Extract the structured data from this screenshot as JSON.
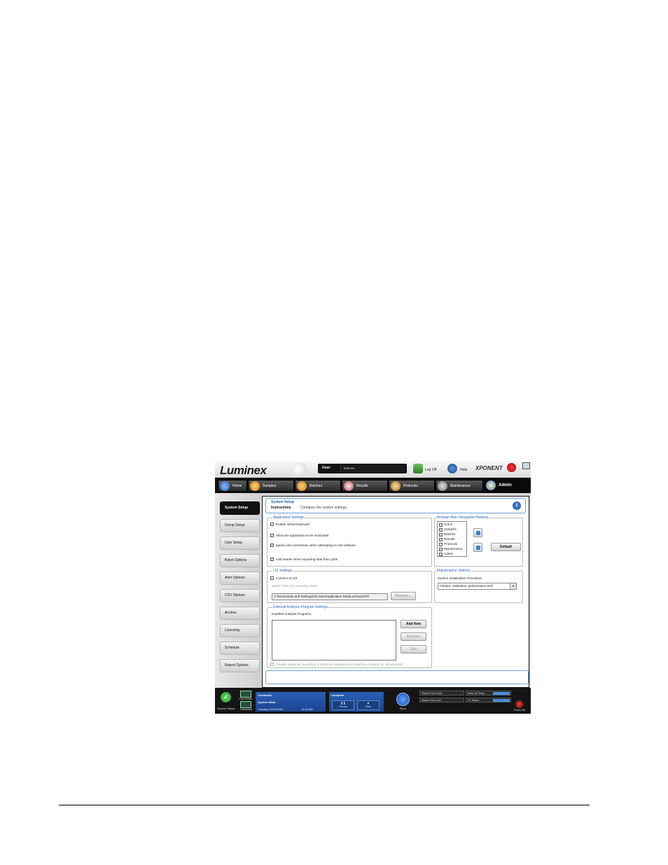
{
  "app": {
    "logo": "Luminex",
    "user_label": "User:",
    "user_value": "luminex",
    "logoff_label": "Log Off",
    "help_label": "Help",
    "brand": "XPONENT"
  },
  "nav": {
    "tabs": [
      {
        "label": "Home",
        "icon": "home-icon",
        "color": "#4a8be0"
      },
      {
        "label": "Samples",
        "icon": "samples-icon",
        "color": "#e0a030"
      },
      {
        "label": "Batches",
        "icon": "batches-icon",
        "color": "#e0a030"
      },
      {
        "label": "Results",
        "icon": "results-icon",
        "color": "#cc3333"
      },
      {
        "label": "Protocols",
        "icon": "protocols-icon",
        "color": "#d08a2a"
      },
      {
        "label": "Maintenance",
        "icon": "maintenance-icon",
        "color": "#888888"
      },
      {
        "label": "Admin",
        "icon": "admin-icon",
        "color": "#e0a030"
      }
    ],
    "active": "Admin"
  },
  "sidebar": {
    "items": [
      "System Setup",
      "Group Setup",
      "User Setup",
      "Batch Options",
      "Alert Options",
      "CSV Options",
      "Archive",
      "Licensing",
      "Schedule",
      "Report Options"
    ],
    "active": "System Setup"
  },
  "header": {
    "title": "System Setup",
    "instructions_label": "Instructions",
    "instructions_text": "Configure the system settings."
  },
  "application_settings": {
    "title": "Application Settings",
    "options": [
      {
        "label": "Enable virtual keyboard",
        "checked": false
      },
      {
        "label": "Allow the application to be minimized",
        "checked": true
      },
      {
        "label": "Ignore user permission when attempting to exit software",
        "checked": true
      },
      {
        "label": "Add header when exporting data from grids",
        "checked": true
      }
    ]
  },
  "arrange_nav": {
    "title": "Arrange Main Navigation Buttons",
    "items": [
      "Home",
      "Samples",
      "Batches",
      "Results",
      "Protocols",
      "Maintenance",
      "Admin"
    ],
    "default_label": "Default"
  },
  "lis_settings": {
    "title": "LIS Settings",
    "connect_label": "Connect to LIS",
    "connect_checked": false,
    "folder_label": "Watch folder for incoming orders",
    "path_value": "C:\\Documents and Settings\\All Users\\Application Data\\Luminex\\xPO",
    "browse_label": "Browse..."
  },
  "maintenance_options": {
    "title": "Maintenance Options",
    "procedure_label": "System Initialization Procedure",
    "procedure_value": "Fluidics, calibration, performance verif"
  },
  "external_analysis": {
    "title": "External Analysis Program Settings",
    "installed_label": "Installed Analysis Programs",
    "add_label": "Add New",
    "remove_label": "Remove",
    "edit_label": "Edit",
    "disable_label": "Disable automatic launching of External Analysis when batches complete for all protocols"
  },
  "status": {
    "system_status_label": "System Status",
    "connected_label": "Connected",
    "unloaded_label": "Unloaded",
    "command_label": "Command:",
    "system_state_label": "System State:",
    "date_value": "Tuesday 10/13/2009",
    "time_value": "11:45 AM",
    "complete_label": "Complete",
    "pause_label": "Pause",
    "stop_label": "Stop",
    "eject_label": "Eject",
    "sheath_label": "Sheath Fluid Level:",
    "waste_label": "Waste Fluid Level:",
    "delta_label": "Delta Cal Temp:",
    "xy_label": "XY Status:",
    "power_label": "Power Off"
  }
}
